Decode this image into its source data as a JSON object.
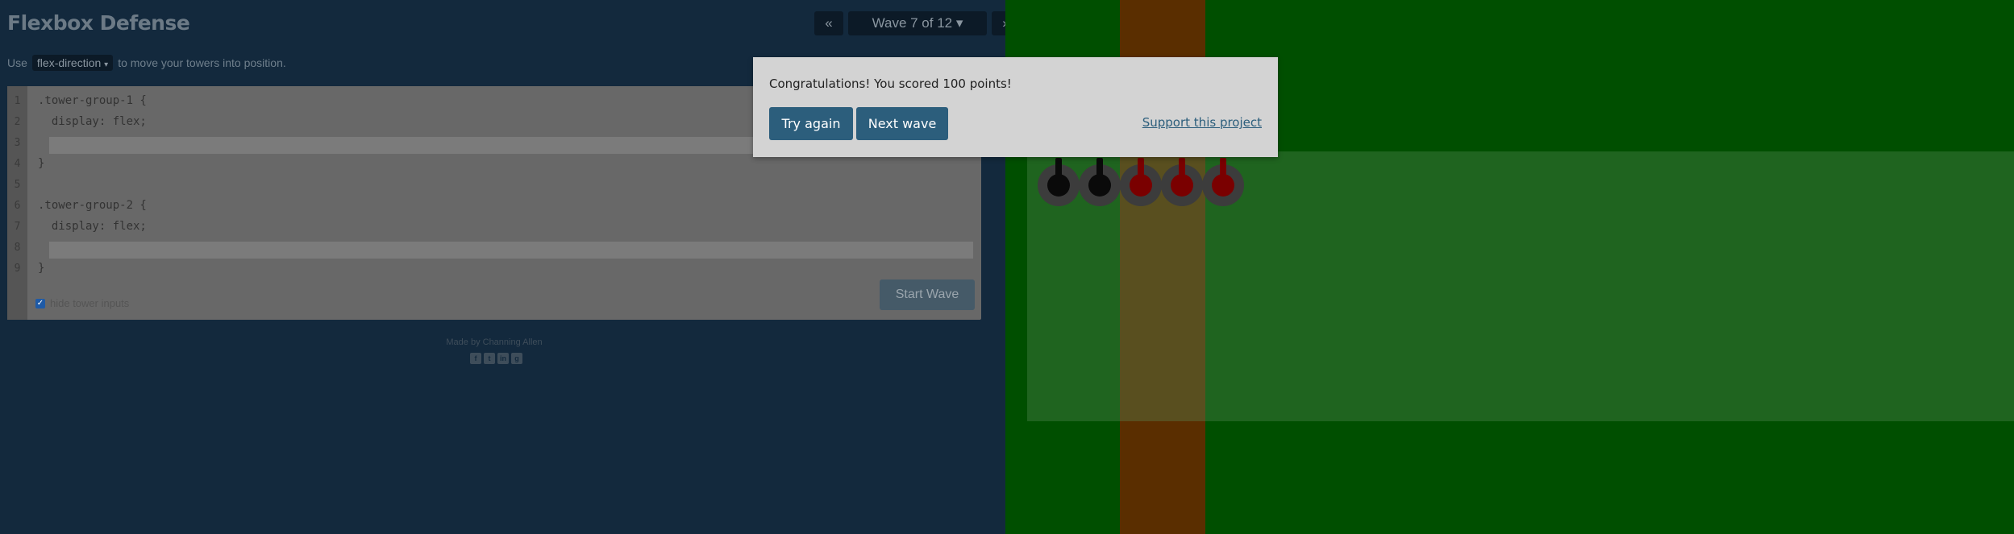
{
  "header": {
    "title": "Flexbox Defense"
  },
  "wave_nav": {
    "prev_icon": "«",
    "wave_label": "Wave 7 of 12",
    "caret_icon": "▾",
    "next_icon": "»"
  },
  "instructions": {
    "prefix": "Use",
    "property": "flex-direction",
    "property_caret": "▾",
    "suffix": "to move your towers into position."
  },
  "editor": {
    "line_numbers": [
      "1",
      "2",
      "3",
      "4",
      "5",
      "6",
      "7",
      "8",
      "9"
    ],
    "lines": [
      ".tower-group-1 {",
      "  display: flex;",
      "",
      "}",
      "",
      ".tower-group-2 {",
      "  display: flex;",
      "",
      "}"
    ],
    "hide_inputs_label": "hide tower inputs",
    "hide_inputs_checked": "✓",
    "start_wave_label": "Start Wave"
  },
  "footer": {
    "credit": "Made by Channing Allen",
    "social_icons": [
      "f",
      "t",
      "in",
      "g"
    ]
  },
  "dialog": {
    "message": "Congratulations! You scored 100 points!",
    "try_again_label": "Try again",
    "next_wave_label": "Next wave",
    "support_label": "Support this project"
  },
  "board": {
    "towers": [
      "black",
      "black",
      "red",
      "red",
      "red"
    ],
    "colors": {
      "grass": "#004f00",
      "road": "#5a2e00",
      "tower_black": "#0a0a0a",
      "tower_red": "#7a0000"
    }
  }
}
